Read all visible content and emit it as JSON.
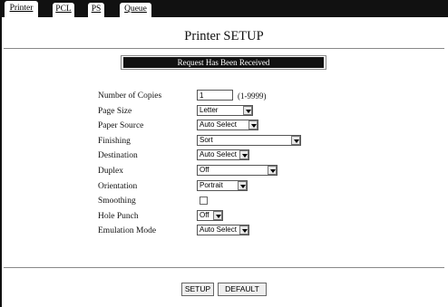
{
  "tabs": [
    {
      "label": "Printer"
    },
    {
      "label": "PCL"
    },
    {
      "label": "PS"
    },
    {
      "label": "Queue"
    }
  ],
  "page": {
    "title": "Printer SETUP",
    "banner": "Request Has Been Received"
  },
  "form": {
    "copies_label": "Number of Copies",
    "copies_value": "1",
    "copies_range": "(1-9999)",
    "page_size_label": "Page Size",
    "page_size_value": "Letter",
    "paper_source_label": "Paper Source",
    "paper_source_value": "Auto Select",
    "finishing_label": "Finishing",
    "finishing_value": "Sort",
    "destination_label": "Destination",
    "destination_value": "Auto Select",
    "duplex_label": "Duplex",
    "duplex_value": "Off",
    "orientation_label": "Orientation",
    "orientation_value": "Portrait",
    "smoothing_label": "Smoothing",
    "smoothing_checked": false,
    "hole_punch_label": "Hole Punch",
    "hole_punch_value": "Off",
    "emulation_label": "Emulation Mode",
    "emulation_value": "Auto Select"
  },
  "buttons": {
    "setup": "SETUP",
    "default": "DEFAULT"
  }
}
